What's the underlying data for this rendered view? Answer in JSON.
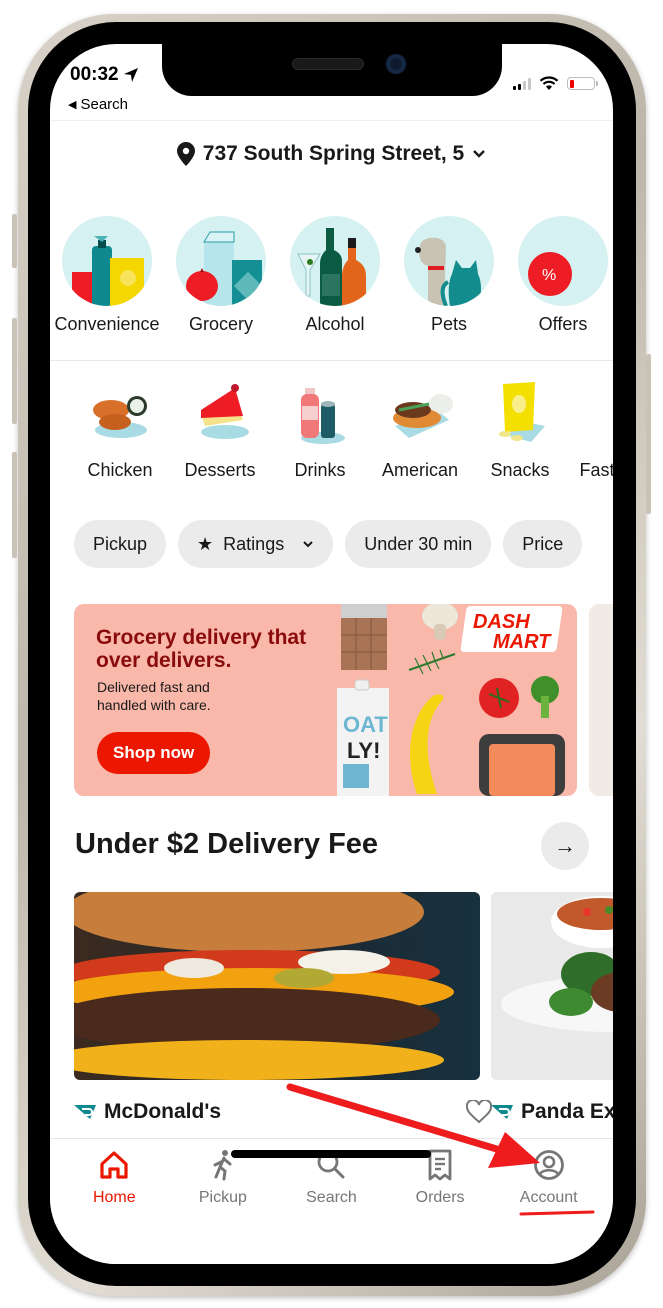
{
  "status_bar": {
    "time": "00:32",
    "back_label": "Search",
    "battery_level_percent": 10
  },
  "header": {
    "address": "737 South Spring Street, 5"
  },
  "store_categories": [
    {
      "label": "Convenience"
    },
    {
      "label": "Grocery"
    },
    {
      "label": "Alcohol"
    },
    {
      "label": "Pets"
    },
    {
      "label": "Offers"
    }
  ],
  "cuisines": [
    {
      "label": "Chicken"
    },
    {
      "label": "Desserts"
    },
    {
      "label": "Drinks"
    },
    {
      "label": "American"
    },
    {
      "label": "Snacks"
    },
    {
      "label": "Fast Food"
    }
  ],
  "filters": [
    {
      "label": "Pickup"
    },
    {
      "label": "Ratings"
    },
    {
      "label": "Under 30 min"
    },
    {
      "label": "Price"
    }
  ],
  "banner": {
    "title": "Grocery delivery that over delivers.",
    "subtitle": "Delivered fast and handled with care.",
    "button": "Shop now",
    "brand_line1": "DASH",
    "brand_line2": "MART",
    "bg_color": "#f9b8a9",
    "accent": "#eb1700"
  },
  "section": {
    "title": "Under $2 Delivery Fee",
    "arrow": "→"
  },
  "stores": [
    {
      "name": "McDonald's"
    },
    {
      "name": "Panda Express"
    }
  ],
  "bottom_nav": [
    {
      "label": "Home",
      "icon": "home-icon",
      "active": true
    },
    {
      "label": "Pickup",
      "icon": "walking-person-icon",
      "active": false
    },
    {
      "label": "Search",
      "icon": "search-icon",
      "active": false
    },
    {
      "label": "Orders",
      "icon": "receipt-icon",
      "active": false
    },
    {
      "label": "Account",
      "icon": "account-icon",
      "active": false
    }
  ],
  "colors": {
    "brand_red": "#eb1700",
    "text": "#191919",
    "muted": "#767676",
    "chip_bg": "#ebebeb",
    "category_bg": "#d6f1f1"
  }
}
